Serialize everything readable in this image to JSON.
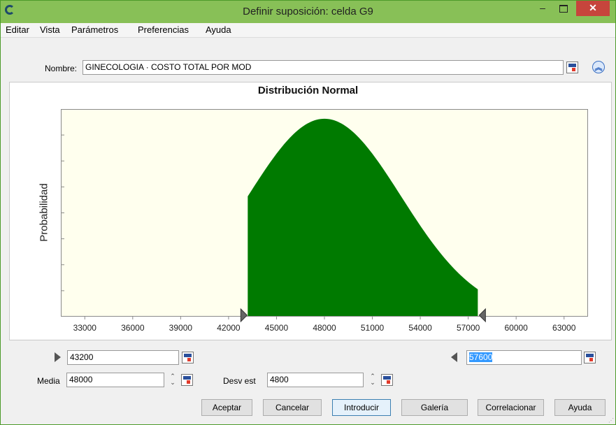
{
  "window": {
    "title": "Definir suposición: celda G9"
  },
  "menu": [
    "Editar",
    "Vista",
    "Parámetros",
    "Preferencias",
    "Ayuda"
  ],
  "name_row": {
    "label": "Nombre:",
    "value": "GINECOLOGIA ·  COSTO TOTAL POR MOD"
  },
  "chart_data": {
    "type": "area",
    "title": "Distribución Normal",
    "ylabel": "Probabilidad",
    "xlabel": "",
    "xlim": [
      31500,
      64500
    ],
    "x_ticks": [
      "33000",
      "36000",
      "39000",
      "42000",
      "45000",
      "48000",
      "51000",
      "54000",
      "57000",
      "60000",
      "63000"
    ],
    "distribution": {
      "mean": 48000,
      "std_dev": 4800
    },
    "shaded_range": [
      43200,
      57600
    ],
    "fill_color": "#007a00",
    "plot_background": "#ffffee",
    "grid": false
  },
  "bounds": {
    "lower": "43200",
    "upper": "57600"
  },
  "params": {
    "mean_label": "Media",
    "mean_value": "48000",
    "sd_label": "Desv est",
    "sd_value": "4800"
  },
  "buttons": {
    "accept": "Aceptar",
    "cancel": "Cancelar",
    "enter": "Introducir",
    "gallery": "Galería",
    "correlate": "Correlacionar",
    "help": "Ayuda"
  }
}
